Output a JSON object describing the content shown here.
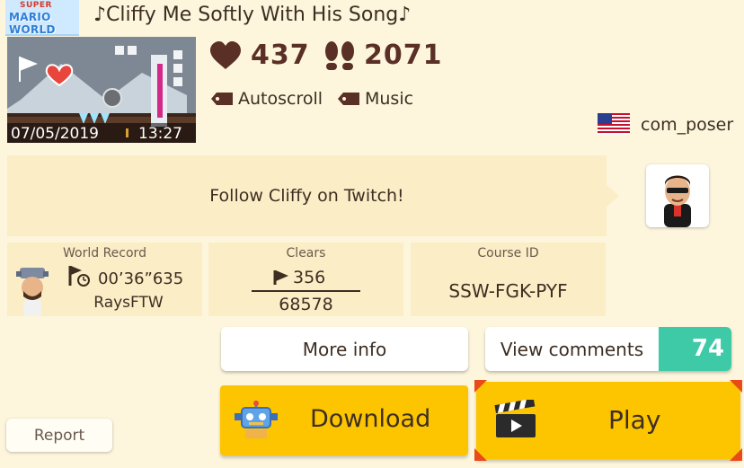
{
  "game_style": {
    "logo_top": "SUPER",
    "logo_bottom": "MARIO WORLD"
  },
  "course": {
    "title": "♪Cliffy Me Softly With His Song♪",
    "upload_date": "07/05/2019",
    "upload_time": "13:27",
    "likes": "437",
    "plays": "2071",
    "tags": [
      "Autoscroll",
      "Music"
    ],
    "comment": "Follow Cliffy on Twitch!"
  },
  "creator": {
    "name": "com_poser",
    "country_flag": "us-flag-icon"
  },
  "world_record": {
    "label": "World Record",
    "time": "00’36”635",
    "holder": "RaysFTW"
  },
  "clears": {
    "label": "Clears",
    "cleared": "356",
    "attempts": "68578"
  },
  "course_id": {
    "label": "Course ID",
    "value": "SSW-FGK-PYF"
  },
  "buttons": {
    "more_info": "More info",
    "view_comments": "View comments",
    "comment_count": "74",
    "download": "Download",
    "play": "Play",
    "report": "Report"
  },
  "colors": {
    "accent_yellow": "#fdc500",
    "comment_teal": "#3ec9a7",
    "corner_red": "#e84a1a",
    "stat_brown": "#5a3026"
  }
}
